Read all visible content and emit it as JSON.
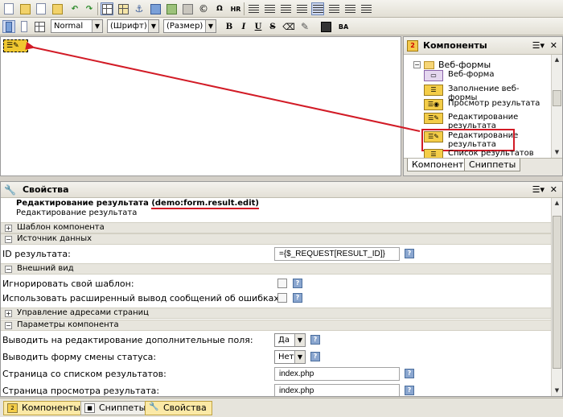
{
  "toolbar1": {
    "icons": [
      "new-page-icon",
      "save-icon",
      "open-icon",
      "template-icon",
      "undo-icon",
      "redo-icon",
      "show-borders-icon",
      "table-icon",
      "anchor-icon",
      "image-icon",
      "flash-icon",
      "copyright-icon",
      "hr-icon",
      "ordered-list-icon",
      "unordered-list-icon",
      "outdent-icon",
      "indent-icon",
      "align-left-icon",
      "align-center-icon",
      "align-right-icon",
      "justify-icon"
    ],
    "hr_label": "HR",
    "copyright_symbol": "©"
  },
  "toolbar2": {
    "style_value": "Normal",
    "font_value": "(Шрифт)",
    "size_value": "(Размер)",
    "bold_label": "B",
    "italic_label": "I",
    "underline_label": "U",
    "strike_label": "S"
  },
  "components_panel": {
    "title": "Компоненты",
    "folder_label": "Веб-формы",
    "items": [
      {
        "label": "Веб-форма",
        "icon": "web-form-icon"
      },
      {
        "label": "Заполнение веб-формы",
        "icon": "form-fill-icon"
      },
      {
        "label": "Просмотр результата",
        "icon": "result-view-icon"
      },
      {
        "label": "Редактирование результата",
        "icon": "result-edit-icon"
      },
      {
        "label": "Редактирование результата",
        "icon": "result-edit-icon",
        "selected": true
      },
      {
        "label": "Список результатов",
        "icon": "result-list-icon"
      }
    ],
    "tabs": [
      "Компоненты",
      "Сниппеты"
    ]
  },
  "properties_panel": {
    "title": "Свойства",
    "component_name": "Редактирование результата",
    "component_id": "(demo:form.result.edit)",
    "component_desc": "Редактирование результата",
    "groups": {
      "template": "Шаблон компонента",
      "data_source": "Источник данных",
      "appearance": "Внешний вид",
      "url_management": "Управление адресами страниц",
      "component_params": "Параметры компонента"
    },
    "rows": {
      "result_id_label": "ID результата:",
      "result_id_value": "={$_REQUEST[RESULT_ID]}",
      "ignore_template_label": "Игнорировать свой шаблон:",
      "extended_errors_label": "Использовать расширенный вывод сообщений об ошибках:",
      "additional_field_label": "Выводить на редактирование дополнительные поля:",
      "additional_field_value": "Да",
      "status_form_label": "Выводить форму смены статуса:",
      "status_form_value": "Нет",
      "list_page_label": "Страница со списком результатов:",
      "list_page_value": "index.php",
      "view_page_label": "Страница просмотра результата:",
      "view_page_value": "index.php"
    }
  },
  "bottom_tabs": [
    "Компоненты",
    "Сниппеты",
    "Свойства"
  ],
  "colors": {
    "accent_red": "#d21b26",
    "component_yellow": "#f0c830",
    "active_tab": "#fbe9a6"
  }
}
